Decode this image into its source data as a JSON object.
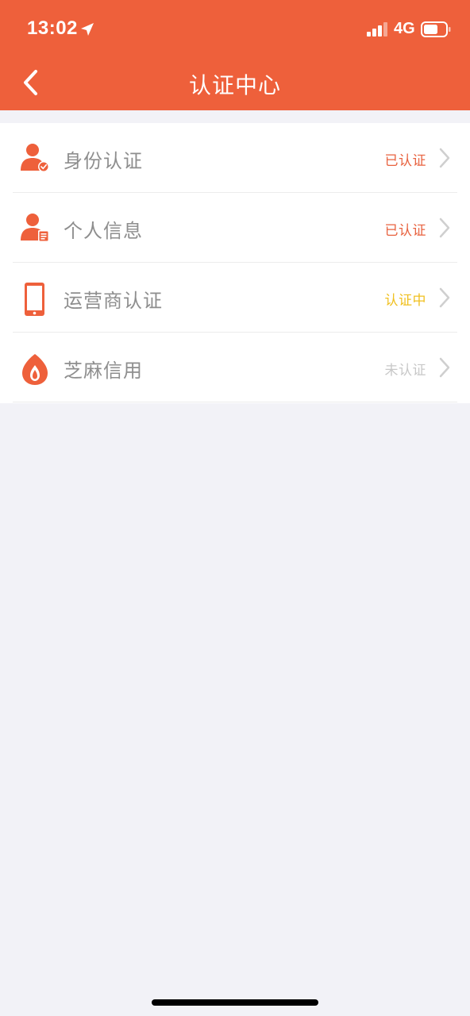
{
  "status_bar": {
    "time": "13:02",
    "network": "4G"
  },
  "nav": {
    "title": "认证中心"
  },
  "items": [
    {
      "label": "身份认证",
      "status": "已认证",
      "status_color": "#e8623f",
      "icon": "id-person-check-icon"
    },
    {
      "label": "个人信息",
      "status": "已认证",
      "status_color": "#e8623f",
      "icon": "person-document-icon"
    },
    {
      "label": "运营商认证",
      "status": "认证中",
      "status_color": "#f0c020",
      "icon": "mobile-phone-icon"
    },
    {
      "label": "芝麻信用",
      "status": "未认证",
      "status_color": "#c8c8c8",
      "icon": "sesame-credit-icon"
    }
  ],
  "colors": {
    "accent": "#ee603b",
    "background": "#f2f2f7"
  }
}
